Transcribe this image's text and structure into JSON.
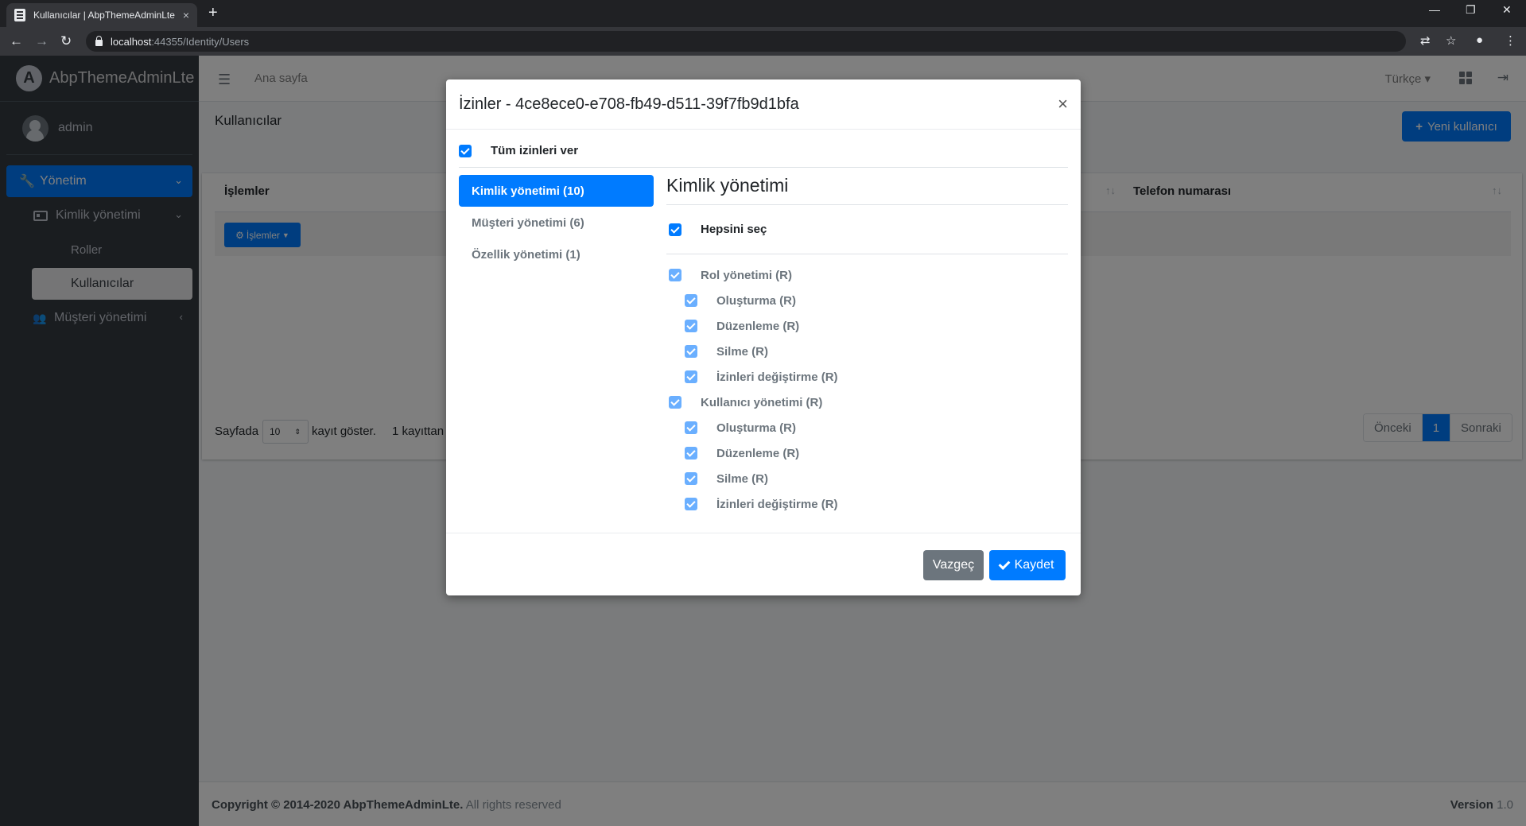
{
  "browser": {
    "tab_title": "Kullanıcılar | AbpThemeAdminLte",
    "tab_close": "×",
    "new_tab": "+",
    "url_host": "localhost",
    "url_path": ":44355/Identity/Users",
    "win_min": "—",
    "win_max": "❐",
    "win_close": "✕"
  },
  "sidebar": {
    "brand": "AbpThemeAdminLte",
    "brand_letter": "A",
    "user": "admin",
    "items": [
      {
        "label": "Yönetim"
      },
      {
        "label": "Kimlik yönetimi"
      },
      {
        "label": "Roller"
      },
      {
        "label": "Kullanıcılar"
      },
      {
        "label": "Müşteri yönetimi"
      }
    ]
  },
  "topnav": {
    "home": "Ana sayfa",
    "language": "Türkçe"
  },
  "page": {
    "title": "Kullanıcılar",
    "new_user": "Yeni kullanıcı",
    "col_actions": "İşlemler",
    "col_phone": "Telefon numarası",
    "actions_button": "İşlemler",
    "show_prefix": "Sayfada",
    "page_size": "10",
    "show_suffix": "kayıt göster.",
    "records": "1 kayıttan",
    "prev": "Önceki",
    "current_page": "1",
    "next": "Sonraki"
  },
  "footer": {
    "copyright_bold": "Copyright © 2014-2020 AbpThemeAdminLte.",
    "copyright_rest": "All rights reserved",
    "version_label": "Version",
    "version": "1.0"
  },
  "modal": {
    "title": "İzinler - 4ce8ece0-e708-fb49-d511-39f7fb9d1bfa",
    "close": "×",
    "grant_all": "Tüm izinleri ver",
    "tabs": [
      {
        "label": "Kimlik yönetimi (10)"
      },
      {
        "label": "Müşteri yönetimi (6)"
      },
      {
        "label": "Özellik yönetimi (1)"
      }
    ],
    "panel_title": "Kimlik yönetimi",
    "select_all": "Hepsini seç",
    "permissions": [
      {
        "label": "Rol yönetimi (R)"
      },
      {
        "label": "Oluşturma (R)"
      },
      {
        "label": "Düzenleme (R)"
      },
      {
        "label": "Silme (R)"
      },
      {
        "label": "İzinleri değiştirme (R)"
      },
      {
        "label": "Kullanıcı yönetimi (R)"
      },
      {
        "label": "Oluşturma (R)"
      },
      {
        "label": "Düzenleme (R)"
      },
      {
        "label": "Silme (R)"
      },
      {
        "label": "İzinleri değiştirme (R)"
      }
    ],
    "cancel": "Vazgeç",
    "save": "Kaydet"
  },
  "colors": {
    "primary": "#007bff",
    "sidebar": "#343a40",
    "secondary": "#6c757d"
  }
}
